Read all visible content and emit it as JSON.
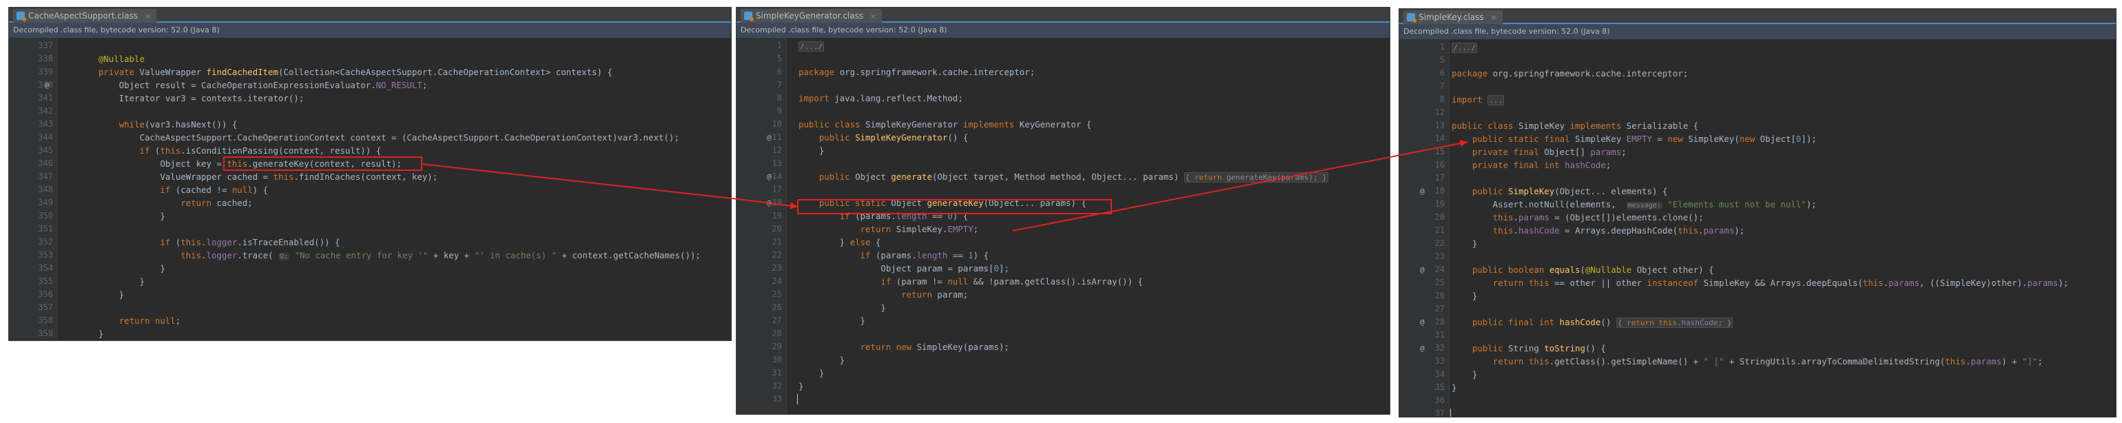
{
  "colors": {
    "arrow": "#e02121",
    "accent": "#4a88c7",
    "bg": "#2b2b2b"
  },
  "common": {
    "banner": "Decompiled .class file, bytecode version: 52.0 (Java 8)",
    "close_glyph": "×",
    "class_icon": "java-class-file-icon"
  },
  "panels": [
    {
      "tab": "CacheAspectSupport.class",
      "lines": [
        {
          "n": "337",
          "html": ""
        },
        {
          "n": "338",
          "html": "    <span class='ann'>@Nullable</span>"
        },
        {
          "n": "339",
          "html": "    <span class='kw'>private</span> ValueWrapper <span class='fn'>findCachedItem</span>(Collection&lt;CacheAspectSupport.CacheOperationContext&gt; contexts) {"
        },
        {
          "n": "340",
          "html": "        Object result = CacheOperationExpressionEvaluator.<span class='fld'>NO_RESULT</span>;"
        },
        {
          "n": "341",
          "html": "        Iterator var3 = contexts.iterator();"
        },
        {
          "n": "342",
          "html": ""
        },
        {
          "n": "343",
          "html": "        <span class='kw'>while</span>(var3.hasNext()) {"
        },
        {
          "n": "344",
          "html": "            CacheAspectSupport.CacheOperationContext context = (CacheAspectSupport.CacheOperationContext)var3.next();"
        },
        {
          "n": "345",
          "html": "            <span class='kw'>if</span> (<span class='kw'>this</span>.isConditionPassing(context, result)) {"
        },
        {
          "n": "346",
          "html": "                Object key = <span class='kw'>this</span>.generateKey(context, result);"
        },
        {
          "n": "347",
          "html": "                ValueWrapper cached = <span class='kw'>this</span>.findInCaches(context, key);"
        },
        {
          "n": "348",
          "html": "                <span class='kw'>if</span> (cached != <span class='kw'>null</span>) {"
        },
        {
          "n": "349",
          "html": "                    <span class='kw'>return</span> cached;"
        },
        {
          "n": "350",
          "html": "                }"
        },
        {
          "n": "351",
          "html": ""
        },
        {
          "n": "352",
          "html": "                <span class='kw'>if</span> (<span class='kw'>this</span>.<span class='fld'>logger</span>.isTraceEnabled()) {"
        },
        {
          "n": "353",
          "html": "                    <span class='kw'>this</span>.<span class='fld'>logger</span>.trace( <span class='hint'>O:</span> <span class='str'>\"No cache entry for key '\"</span> + key + <span class='str'>\"' in cache(s) \"</span> + context.getCacheNames());"
        },
        {
          "n": "354",
          "html": "                }"
        },
        {
          "n": "355",
          "html": "            }"
        },
        {
          "n": "356",
          "html": "        }"
        },
        {
          "n": "357",
          "html": ""
        },
        {
          "n": "358",
          "html": "        <span class='kw'>return null</span>;"
        },
        {
          "n": "359",
          "html": "    }"
        }
      ],
      "markers": [
        {
          "line": 3,
          "text": "@"
        }
      ]
    },
    {
      "tab": "SimpleKeyGenerator.class",
      "lines": [
        {
          "n": "1",
          "html": "<span class='fold'>/.../</span>"
        },
        {
          "n": "5",
          "html": ""
        },
        {
          "n": "6",
          "html": "<span class='kw'>package</span> org.springframework.cache.interceptor;"
        },
        {
          "n": "7",
          "html": ""
        },
        {
          "n": "8",
          "html": "<span class='kw'>import</span> java.lang.reflect.Method;"
        },
        {
          "n": "9",
          "html": ""
        },
        {
          "n": "10",
          "html": "<span class='kw'>public class</span> SimpleKeyGenerator <span class='kw'>implements</span> KeyGenerator {"
        },
        {
          "n": "11",
          "html": "    <span class='kw'>public</span> <span class='fn'>SimpleKeyGenerator</span>() {"
        },
        {
          "n": "12",
          "html": "    }"
        },
        {
          "n": "13",
          "html": ""
        },
        {
          "n": "14",
          "html": "    <span class='kw'>public</span> Object <span class='fn'>generate</span>(Object target, Method method, Object... params) <span class='fold'>{ <span class='kw'>return</span> generateKey(params); }</span>"
        },
        {
          "n": "17",
          "html": ""
        },
        {
          "n": "18",
          "html": "    <span class='kw'>public static</span> Object <span class='fn'>generateKey</span>(Object... params) {"
        },
        {
          "n": "19",
          "html": "        <span class='kw'>if</span> (params.<span class='fld'>length</span> == <span class='num'>0</span>) {"
        },
        {
          "n": "20",
          "html": "            <span class='kw'>return</span> SimpleKey.<span class='fld'>EMPTY</span>;"
        },
        {
          "n": "21",
          "html": "        } <span class='kw'>else</span> {"
        },
        {
          "n": "22",
          "html": "            <span class='kw'>if</span> (params.<span class='fld'>length</span> == <span class='num'>1</span>) {"
        },
        {
          "n": "23",
          "html": "                Object param = params[<span class='num'>0</span>];"
        },
        {
          "n": "24",
          "html": "                <span class='kw'>if</span> (param != <span class='kw'>null</span> &amp;&amp; !param.getClass().isArray()) {"
        },
        {
          "n": "25",
          "html": "                    <span class='kw'>return</span> param;"
        },
        {
          "n": "26",
          "html": "                }"
        },
        {
          "n": "27",
          "html": "            }"
        },
        {
          "n": "28",
          "html": ""
        },
        {
          "n": "29",
          "html": "            <span class='kw'>return new</span> SimpleKey(params);"
        },
        {
          "n": "30",
          "html": "        }"
        },
        {
          "n": "31",
          "html": "    }"
        },
        {
          "n": "32",
          "html": "}"
        },
        {
          "n": "33",
          "html": ""
        }
      ],
      "markers": [
        {
          "line": 7,
          "text": "@"
        },
        {
          "line": 10,
          "text": "@"
        },
        {
          "line": 12,
          "text": "@"
        }
      ]
    },
    {
      "tab": "SimpleKey.class",
      "lines": [
        {
          "n": "1",
          "html": "<span class='fold'>/.../</span>"
        },
        {
          "n": "5",
          "html": ""
        },
        {
          "n": "6",
          "html": "<span class='kw'>package</span> org.springframework.cache.interceptor;"
        },
        {
          "n": "7",
          "html": ""
        },
        {
          "n": "8",
          "html": "<span class='kw'>import</span> <span class='fold'>...</span>"
        },
        {
          "n": "12",
          "html": ""
        },
        {
          "n": "13",
          "html": "<span class='kw'>public class</span> SimpleKey <span class='kw'>implements</span> Serializable {"
        },
        {
          "n": "14",
          "html": "    <span class='kw'>public static final</span> SimpleKey <span class='fld'>EMPTY</span> = <span class='kw'>new</span> SimpleKey(<span class='kw'>new</span> Object[<span class='num'>0</span>]);"
        },
        {
          "n": "15",
          "html": "    <span class='kw'>private final</span> Object[] <span class='fld'>params</span>;"
        },
        {
          "n": "16",
          "html": "    <span class='kw'>private final int</span> <span class='fld'>hashCode</span>;"
        },
        {
          "n": "17",
          "html": ""
        },
        {
          "n": "18",
          "html": "    <span class='kw'>public</span> <span class='fn'>SimpleKey</span>(Object... elements) {"
        },
        {
          "n": "19",
          "html": "        Assert.notNull(elements,  <span class='hint'>message:</span> <span class='str'>\"Elements must not be null\"</span>);"
        },
        {
          "n": "20",
          "html": "        <span class='kw'>this</span>.<span class='fld'>params</span> = (Object[])elements.clone();"
        },
        {
          "n": "21",
          "html": "        <span class='kw'>this</span>.<span class='fld'>hashCode</span> = Arrays.deepHashCode(<span class='kw'>this</span>.<span class='fld'>params</span>);"
        },
        {
          "n": "22",
          "html": "    }"
        },
        {
          "n": "23",
          "html": ""
        },
        {
          "n": "24",
          "html": "    <span class='kw'>public boolean</span> <span class='fn'>equals</span>(<span class='ann'>@Nullable</span> Object other) {"
        },
        {
          "n": "25",
          "html": "        <span class='kw'>return this</span> == other || other <span class='kw'>instanceof</span> SimpleKey &amp;&amp; Arrays.deepEquals(<span class='kw'>this</span>.<span class='fld'>params</span>, ((SimpleKey)other).<span class='fld'>params</span>);"
        },
        {
          "n": "26",
          "html": "    }"
        },
        {
          "n": "27",
          "html": ""
        },
        {
          "n": "28",
          "html": "    <span class='kw'>public final int</span> <span class='fn'>hashCode</span>() <span class='fold'>{ <span class='kw'>return this</span>.<span class='fld'>hashCode</span>; }</span>"
        },
        {
          "n": "31",
          "html": ""
        },
        {
          "n": "32",
          "html": "    <span class='kw'>public</span> String <span class='fn'>toString</span>() {"
        },
        {
          "n": "33",
          "html": "        <span class='kw'>return this</span>.getClass().getSimpleName() + <span class='str'>\" [\"</span> + StringUtils.arrayToCommaDelimitedString(<span class='kw'>this</span>.<span class='fld'>params</span>) + <span class='str'>\"]\"</span>;"
        },
        {
          "n": "34",
          "html": "    }"
        },
        {
          "n": "35",
          "html": "}"
        },
        {
          "n": "36",
          "html": ""
        },
        {
          "n": "37",
          "html": ""
        }
      ],
      "markers": [
        {
          "line": 11,
          "text": "@"
        },
        {
          "line": 17,
          "text": "@"
        },
        {
          "line": 21,
          "text": "@"
        },
        {
          "line": 23,
          "text": "@"
        }
      ]
    }
  ]
}
